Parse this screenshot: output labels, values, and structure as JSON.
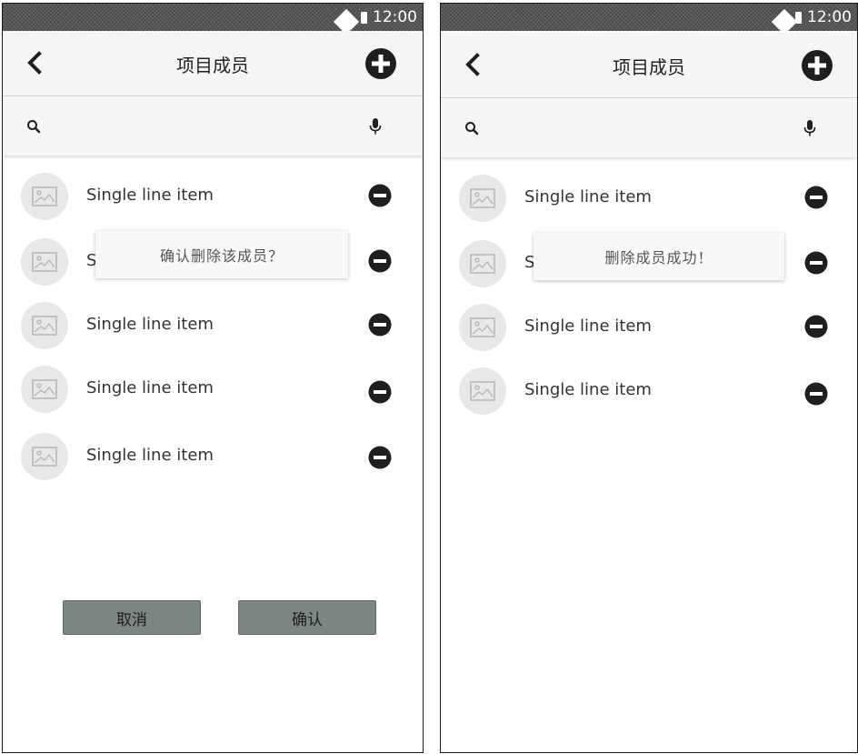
{
  "status_bar": {
    "time": "12:00"
  },
  "app_bar": {
    "title": "项目成员"
  },
  "search": {
    "placeholder": ""
  },
  "left_screen": {
    "items": [
      {
        "label": "Single line item"
      },
      {
        "label": "S"
      },
      {
        "label": "Single line item"
      },
      {
        "label": "Single line item"
      },
      {
        "label": "Single line item"
      }
    ],
    "dialog_message": "确认删除该成员？",
    "cancel_label": "取消",
    "confirm_label": "确认"
  },
  "right_screen": {
    "items": [
      {
        "label": "Single line item"
      },
      {
        "label": "S"
      },
      {
        "label": "Single line item"
      },
      {
        "label": "Single line item"
      }
    ],
    "toast_message": "删除成员成功！"
  },
  "icons": {
    "back": "chevron-left-icon",
    "add": "plus-circle-icon",
    "search": "search-icon",
    "mic": "microphone-icon",
    "avatar": "image-placeholder-icon",
    "remove": "minus-circle-icon"
  },
  "colors": {
    "status_bar": "#4a4a4a",
    "app_bar": "#f5f5f5",
    "button": "#7c8682",
    "icon": "#1f1f1f"
  }
}
